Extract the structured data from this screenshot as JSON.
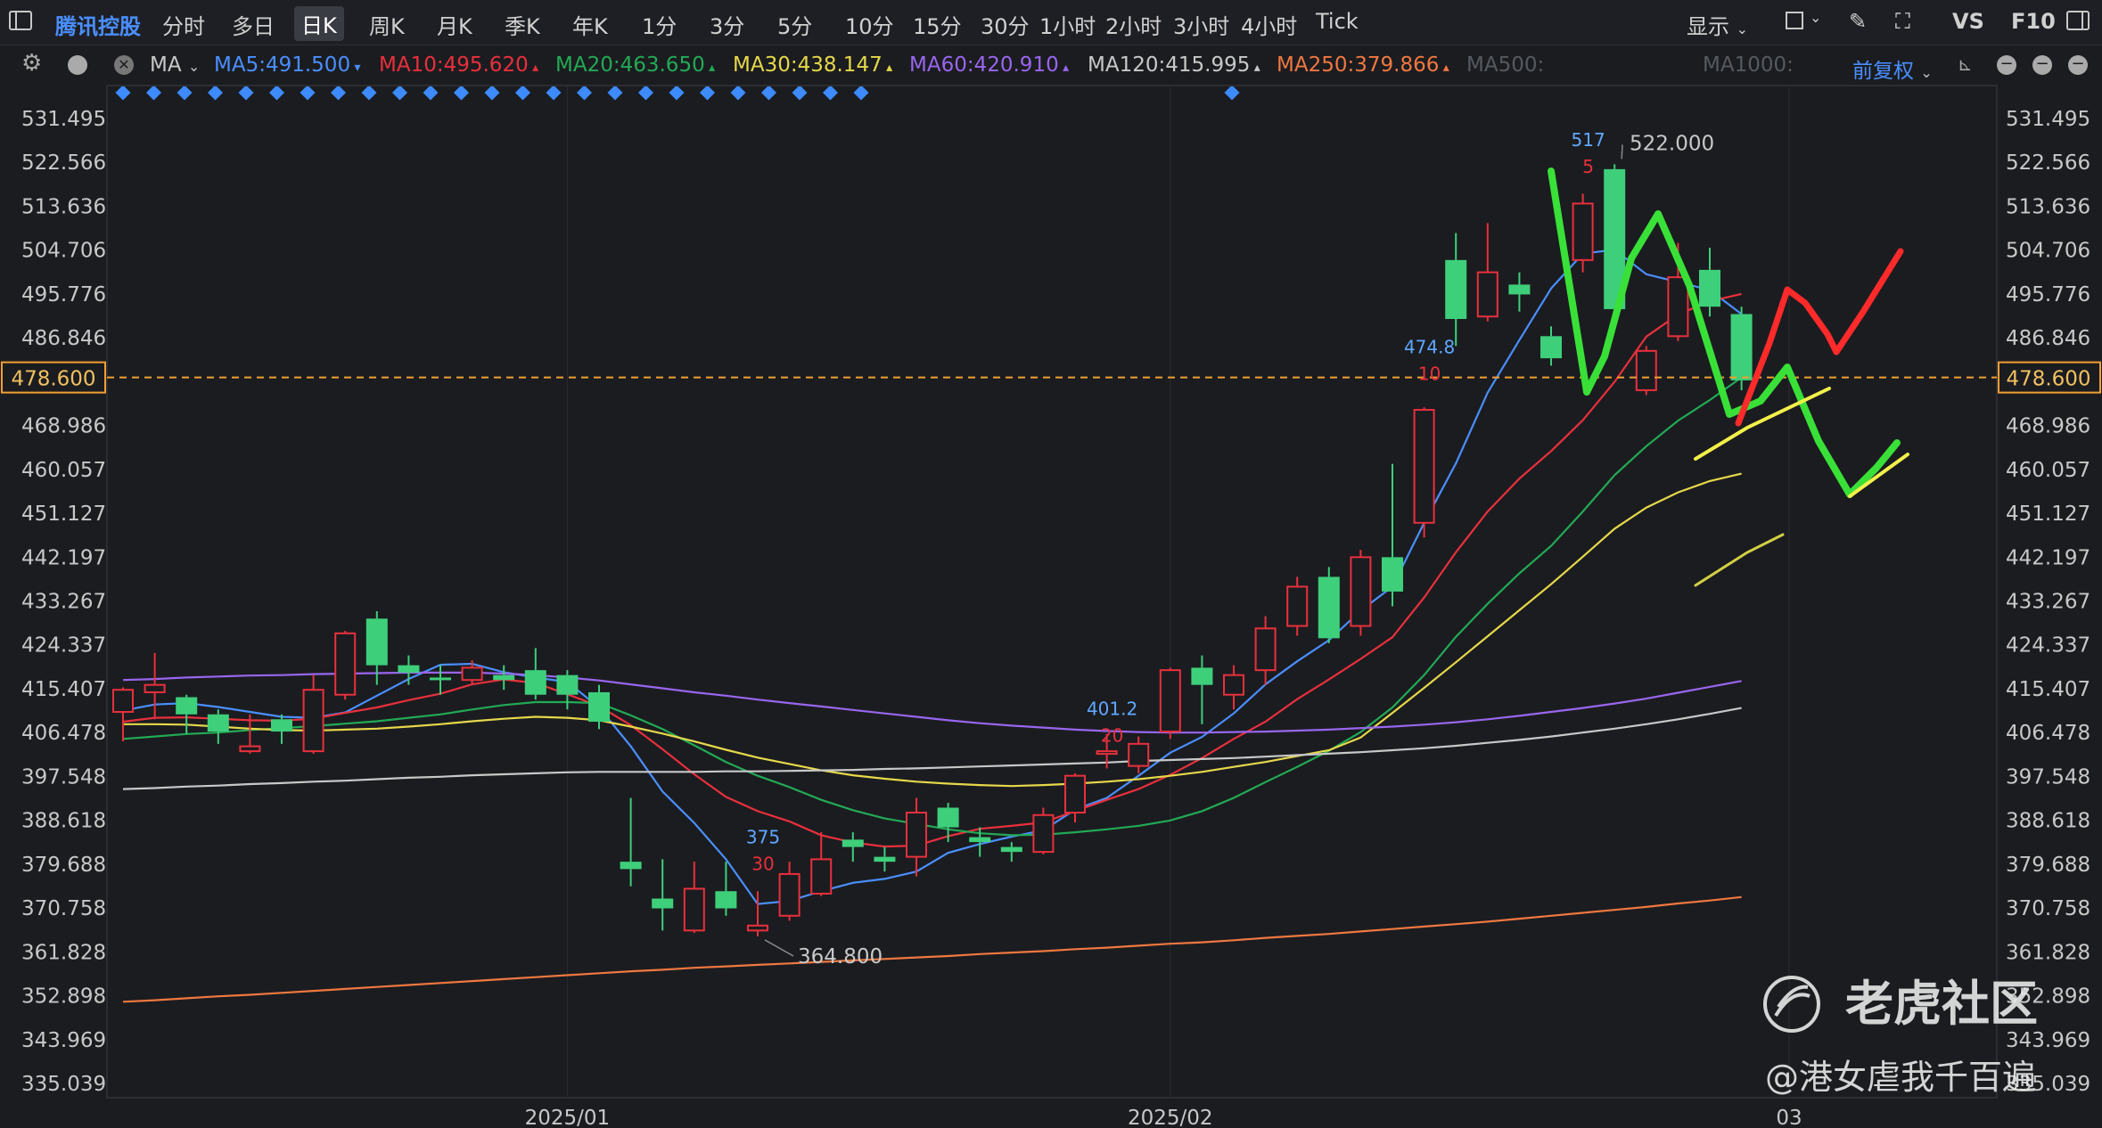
{
  "toolbar": {
    "symbol": "腾讯控股",
    "periods": [
      "分时",
      "多日",
      "日K",
      "周K",
      "月K",
      "季K",
      "年K",
      "1分",
      "3分",
      "5分",
      "10分",
      "15分",
      "30分",
      "1小时",
      "2小时",
      "3小时",
      "4小时",
      "Tick"
    ],
    "active_period": "日K",
    "display_label": "显示",
    "vs_label": "VS",
    "f10_label": "F10"
  },
  "indicator_bar": {
    "ma_label": "MA",
    "adjust_label": "前复权",
    "ma_items": [
      {
        "label": "MA5:491.500",
        "color": "#4a8fff"
      },
      {
        "label": "MA10:495.620",
        "color": "#e8303c"
      },
      {
        "label": "MA20:463.650",
        "color": "#22aa55"
      },
      {
        "label": "MA30:438.147",
        "color": "#e6d84a"
      },
      {
        "label": "MA60:420.910",
        "color": "#9966ee"
      },
      {
        "label": "MA120:415.995",
        "color": "#c8c8c8"
      },
      {
        "label": "MA250:379.866",
        "color": "#f07840"
      },
      {
        "label": "MA500:",
        "color": "#555a60"
      },
      {
        "label": "MA1000:",
        "color": "#555a60"
      }
    ]
  },
  "chart_data": {
    "type": "candlestick",
    "ylim": [
      335.039,
      531.495
    ],
    "y_ticks": [
      "531.495",
      "522.566",
      "513.636",
      "504.706",
      "495.776",
      "486.846",
      "478.600",
      "468.986",
      "460.057",
      "451.127",
      "442.197",
      "433.267",
      "424.337",
      "415.407",
      "406.478",
      "397.548",
      "388.618",
      "379.688",
      "370.758",
      "361.828",
      "352.898",
      "343.969",
      "335.039"
    ],
    "x_labels": [
      {
        "label": "2025/01",
        "index": 14
      },
      {
        "label": "2025/02",
        "index": 33
      },
      {
        "label": "03",
        "index": 52.5
      }
    ],
    "current_price": "478.600",
    "candles": [
      {
        "o": 410.5,
        "c": 415.0,
        "h": 415.5,
        "l": 404.5
      },
      {
        "o": 414.5,
        "c": 416.0,
        "h": 422.5,
        "l": 409.0
      },
      {
        "o": 413.5,
        "c": 410.0,
        "h": 414.0,
        "l": 406.0
      },
      {
        "o": 410.0,
        "c": 406.5,
        "h": 411.0,
        "l": 404.0
      },
      {
        "o": 402.5,
        "c": 403.5,
        "h": 410.0,
        "l": 402.0
      },
      {
        "o": 409.0,
        "c": 406.5,
        "h": 410.0,
        "l": 404.0
      },
      {
        "o": 402.5,
        "c": 415.0,
        "h": 418.0,
        "l": 402.0
      },
      {
        "o": 414.0,
        "c": 426.5,
        "h": 427.0,
        "l": 413.0
      },
      {
        "o": 429.5,
        "c": 420.0,
        "h": 431.0,
        "l": 416.0
      },
      {
        "o": 420.0,
        "c": 418.5,
        "h": 422.0,
        "l": 416.0
      },
      {
        "o": 417.5,
        "c": 417.0,
        "h": 420.0,
        "l": 414.0
      },
      {
        "o": 417.0,
        "c": 419.5,
        "h": 421.0,
        "l": 416.0
      },
      {
        "o": 418.0,
        "c": 417.0,
        "h": 420.0,
        "l": 415.0
      },
      {
        "o": 419.0,
        "c": 414.0,
        "h": 423.5,
        "l": 413.0
      },
      {
        "o": 418.0,
        "c": 414.0,
        "h": 419.0,
        "l": 411.0
      },
      {
        "o": 414.5,
        "c": 408.5,
        "h": 416.0,
        "l": 407.0
      },
      {
        "o": 380.0,
        "c": 378.5,
        "h": 393.0,
        "l": 375.0
      },
      {
        "o": 372.5,
        "c": 370.5,
        "h": 380.5,
        "l": 366.0
      },
      {
        "o": 366.0,
        "c": 374.5,
        "h": 380.0,
        "l": 365.5
      },
      {
        "o": 374.0,
        "c": 370.5,
        "h": 380.0,
        "l": 369.0
      },
      {
        "o": 366.0,
        "c": 367.0,
        "h": 374.0,
        "l": 364.8
      },
      {
        "o": 369.0,
        "c": 377.5,
        "h": 380.0,
        "l": 368.0
      },
      {
        "o": 373.5,
        "c": 380.5,
        "h": 386.0,
        "l": 373.0
      },
      {
        "o": 384.5,
        "c": 383.0,
        "h": 386.0,
        "l": 380.0
      },
      {
        "o": 381.0,
        "c": 380.0,
        "h": 383.0,
        "l": 378.0
      },
      {
        "o": 381.0,
        "c": 390.0,
        "h": 393.0,
        "l": 377.0
      },
      {
        "o": 391.0,
        "c": 387.0,
        "h": 392.0,
        "l": 384.0
      },
      {
        "o": 385.0,
        "c": 384.0,
        "h": 387.0,
        "l": 381.0
      },
      {
        "o": 383.0,
        "c": 382.0,
        "h": 384.0,
        "l": 380.0
      },
      {
        "o": 382.0,
        "c": 389.5,
        "h": 391.0,
        "l": 381.5
      },
      {
        "o": 390.0,
        "c": 397.5,
        "h": 398.0,
        "l": 388.0
      },
      {
        "o": 402.0,
        "c": 402.5,
        "h": 406.0,
        "l": 399.0
      },
      {
        "o": 399.5,
        "c": 404.0,
        "h": 405.5,
        "l": 398.0
      },
      {
        "o": 406.5,
        "c": 419.0,
        "h": 419.5,
        "l": 405.0
      },
      {
        "o": 419.5,
        "c": 416.0,
        "h": 422.0,
        "l": 408.0
      },
      {
        "o": 414.0,
        "c": 418.0,
        "h": 420.0,
        "l": 411.0
      },
      {
        "o": 419.0,
        "c": 427.5,
        "h": 430.0,
        "l": 416.0
      },
      {
        "o": 428.0,
        "c": 436.0,
        "h": 438.0,
        "l": 426.0
      },
      {
        "o": 438.0,
        "c": 425.5,
        "h": 440.0,
        "l": 424.5
      },
      {
        "o": 428.0,
        "c": 442.0,
        "h": 443.5,
        "l": 426.0
      },
      {
        "o": 442.0,
        "c": 435.0,
        "h": 461.0,
        "l": 432.0
      },
      {
        "o": 449.0,
        "c": 472.0,
        "h": 472.5,
        "l": 446.0
      },
      {
        "o": 502.5,
        "c": 490.5,
        "h": 508.0,
        "l": 485.0
      },
      {
        "o": 491.0,
        "c": 500.0,
        "h": 510.0,
        "l": 490.0
      },
      {
        "o": 497.5,
        "c": 495.5,
        "h": 500.0,
        "l": 492.0
      },
      {
        "o": 487.0,
        "c": 482.5,
        "h": 489.0,
        "l": 481.0
      },
      {
        "o": 502.5,
        "c": 514.0,
        "h": 516.0,
        "l": 500.0
      },
      {
        "o": 521.0,
        "c": 492.5,
        "h": 522.0,
        "l": 491.5
      },
      {
        "o": 476.0,
        "c": 484.0,
        "h": 485.0,
        "l": 475.0
      },
      {
        "o": 487.0,
        "c": 499.0,
        "h": 506.0,
        "l": 486.0
      },
      {
        "o": 500.5,
        "c": 493.0,
        "h": 505.0,
        "l": 491.0
      },
      {
        "o": 491.5,
        "c": 478.0,
        "h": 493.0,
        "l": 476.0
      }
    ],
    "series": [
      {
        "name": "MA5",
        "color": "#4a8fff",
        "values": [
          410.8,
          412.0,
          412.3,
          411.5,
          410.5,
          409.5,
          409.3,
          410.4,
          413.8,
          417.2,
          420.1,
          420.3,
          418.6,
          417.5,
          416.6,
          411.4,
          403.5,
          394.3,
          387.9,
          380.5,
          371.4,
          372.0,
          374.0,
          375.7,
          376.5,
          378.0,
          381.8,
          383.6,
          385.1,
          386.4,
          390.6,
          393.0,
          397.5,
          402.2,
          405.4,
          410.2,
          416.1,
          420.8,
          425.1,
          431.1,
          436.0,
          449.0,
          461.1,
          475.5,
          486.2,
          496.7,
          503.8,
          504.6,
          499.6,
          498.0,
          496.4,
          491.5
        ]
      },
      {
        "name": "MA10",
        "color": "#e8303c",
        "values": [
          408.5,
          409.3,
          409.4,
          409.1,
          408.8,
          408.7,
          409.1,
          410.3,
          411.4,
          412.9,
          414.2,
          416.1,
          417.1,
          416.4,
          414.1,
          411.7,
          407.8,
          402.9,
          397.8,
          393.2,
          390.3,
          388.2,
          385.4,
          383.9,
          383.1,
          383.3,
          385.2,
          386.7,
          387.3,
          388.0,
          390.3,
          392.6,
          394.8,
          397.7,
          401.1,
          405.0,
          408.5,
          413.1,
          417.1,
          421.3,
          425.7,
          433.8,
          443.0,
          451.3,
          458.0,
          463.6,
          469.9,
          477.7,
          486.9,
          491.4,
          494.1,
          495.6
        ]
      },
      {
        "name": "MA20",
        "color": "#22aa55",
        "values": [
          405.0,
          405.5,
          406.0,
          406.3,
          406.8,
          407.2,
          407.6,
          408.1,
          408.6,
          409.3,
          410.0,
          411.0,
          411.9,
          412.5,
          412.5,
          412.3,
          409.8,
          407.0,
          403.7,
          400.3,
          397.5,
          395.2,
          392.6,
          390.5,
          388.8,
          387.7,
          386.6,
          385.8,
          385.4,
          385.5,
          386.0,
          386.6,
          387.3,
          388.4,
          390.3,
          393.0,
          396.2,
          399.3,
          402.6,
          406.4,
          411.4,
          418.0,
          425.8,
          432.5,
          438.7,
          444.3,
          451.3,
          458.7,
          464.6,
          469.8,
          474.0,
          478.6
        ]
      },
      {
        "name": "MA30",
        "color": "#e6d84a",
        "values": [
          408.0,
          408.0,
          407.9,
          407.5,
          407.1,
          406.8,
          406.7,
          406.9,
          407.1,
          407.5,
          408.0,
          408.6,
          409.1,
          409.5,
          409.3,
          408.8,
          407.5,
          406.1,
          404.5,
          402.8,
          401.2,
          399.9,
          398.6,
          397.6,
          396.9,
          396.3,
          395.9,
          395.6,
          395.4,
          395.6,
          395.9,
          396.3,
          396.8,
          397.5,
          398.3,
          399.3,
          400.3,
          401.5,
          402.7,
          405.3,
          410.3,
          415.4,
          420.6,
          425.9,
          431.2,
          436.5,
          442.1,
          447.8,
          452.1,
          455.2,
          457.5,
          459.0
        ]
      },
      {
        "name": "MA60",
        "color": "#9966ee",
        "values": [
          417.0,
          417.2,
          417.5,
          417.7,
          417.9,
          418.0,
          418.2,
          418.3,
          418.4,
          418.5,
          418.5,
          418.5,
          418.3,
          418.0,
          417.5,
          416.9,
          416.1,
          415.3,
          414.5,
          413.8,
          413.0,
          412.3,
          411.6,
          410.9,
          410.2,
          409.5,
          408.8,
          408.2,
          407.7,
          407.3,
          406.9,
          406.6,
          406.4,
          406.3,
          406.3,
          406.4,
          406.5,
          406.7,
          406.9,
          407.2,
          407.5,
          407.9,
          408.4,
          409.0,
          409.7,
          410.5,
          411.3,
          412.2,
          413.2,
          414.4,
          415.6,
          416.8
        ]
      },
      {
        "name": "MA120",
        "color": "#c8c8c8",
        "values": [
          394.8,
          395.0,
          395.3,
          395.5,
          395.8,
          396.0,
          396.3,
          396.5,
          396.8,
          397.1,
          397.3,
          397.6,
          397.8,
          398.0,
          398.2,
          398.3,
          398.3,
          398.3,
          398.3,
          398.4,
          398.4,
          398.5,
          398.6,
          398.7,
          398.9,
          399.0,
          399.2,
          399.4,
          399.6,
          399.8,
          400.0,
          400.2,
          400.5,
          400.7,
          400.9,
          401.1,
          401.4,
          401.7,
          402.0,
          402.3,
          402.7,
          403.1,
          403.6,
          404.2,
          404.8,
          405.5,
          406.3,
          407.1,
          408.0,
          409.0,
          410.1,
          411.3
        ]
      },
      {
        "name": "MA250",
        "color": "#f07840",
        "values": [
          351.5,
          351.8,
          352.2,
          352.6,
          352.9,
          353.3,
          353.7,
          354.1,
          354.5,
          354.9,
          355.3,
          355.7,
          356.1,
          356.5,
          356.9,
          357.3,
          357.7,
          358.0,
          358.4,
          358.7,
          359.0,
          359.3,
          359.6,
          359.9,
          360.2,
          360.5,
          360.8,
          361.2,
          361.5,
          361.8,
          362.2,
          362.5,
          362.9,
          363.3,
          363.6,
          364.0,
          364.5,
          364.9,
          365.3,
          365.8,
          366.3,
          366.8,
          367.3,
          367.8,
          368.4,
          369.0,
          369.6,
          370.2,
          370.8,
          371.5,
          372.1,
          372.8
        ]
      }
    ],
    "annotations": [
      {
        "price": "517",
        "count": "5",
        "index": 46
      },
      {
        "price": "474.8",
        "count": "10",
        "index": 41
      },
      {
        "price": "401.2",
        "count": "20",
        "index": 31
      },
      {
        "price": "375",
        "count": "30",
        "index": 20
      }
    ],
    "high_label": "522.000",
    "low_label": "364.800"
  },
  "watermark": {
    "brand": "老虎社区",
    "handle": "@港女虐我千百遍"
  }
}
